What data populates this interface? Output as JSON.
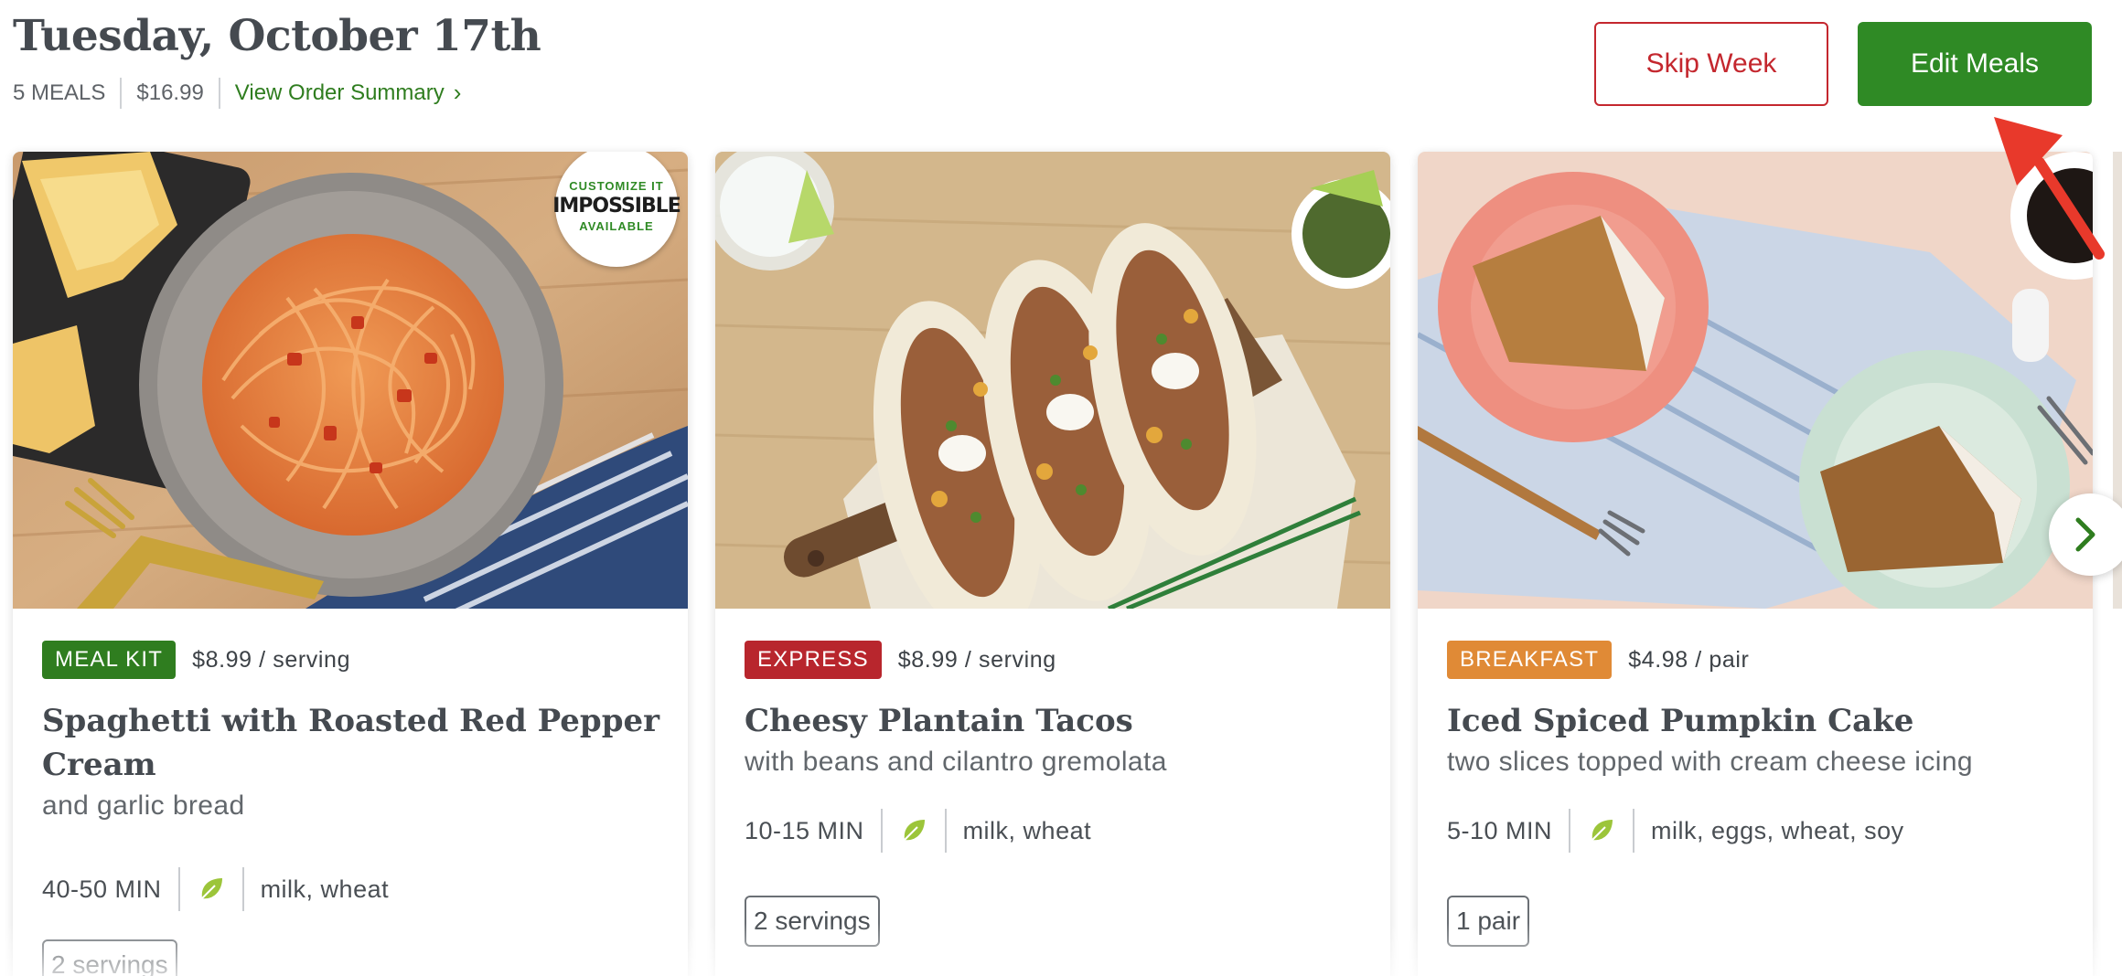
{
  "header": {
    "date_title": "Tuesday, October 17th",
    "meal_count": "5 MEALS",
    "total_price": "$16.99",
    "view_summary_label": "View Order Summary",
    "skip_week_label": "Skip Week",
    "edit_meals_label": "Edit Meals"
  },
  "colors": {
    "brand_green": "#2f8a25",
    "skip_red": "#c4272e",
    "express_red": "#b8262d",
    "breakfast_orange": "#e08a36",
    "arrow_red": "#e8392b"
  },
  "cards": [
    {
      "tag": "MEAL KIT",
      "tag_color": "#2f7d1f",
      "price": "$8.99 / serving",
      "title": "Spaghetti with Roasted Red Pepper Cream",
      "subtitle": "and garlic bread",
      "time": "40-50 MIN",
      "diet_icon": "leaf-icon",
      "allergens": "milk, wheat",
      "servings": "2 servings",
      "badge": {
        "top": "CUSTOMIZE IT",
        "middle": "IMPOSSIBLE",
        "bottom": "AVAILABLE"
      }
    },
    {
      "tag": "EXPRESS",
      "tag_color": "#b8262d",
      "price": "$8.99 / serving",
      "title": "Cheesy Plantain Tacos",
      "subtitle": "with beans and cilantro gremolata",
      "time": "10-15 MIN",
      "diet_icon": "leaf-icon",
      "allergens": "milk, wheat",
      "servings": "2 servings"
    },
    {
      "tag": "BREAKFAST",
      "tag_color": "#e08a36",
      "price": "$4.98 / pair",
      "title": "Iced Spiced Pumpkin Cake",
      "subtitle": "two slices topped with cream cheese icing",
      "time": "5-10 MIN",
      "diet_icon": "leaf-icon",
      "allergens": "milk, eggs, wheat, soy",
      "servings": "1 pair"
    }
  ],
  "carousel": {
    "next_icon": "chevron-right-icon"
  }
}
